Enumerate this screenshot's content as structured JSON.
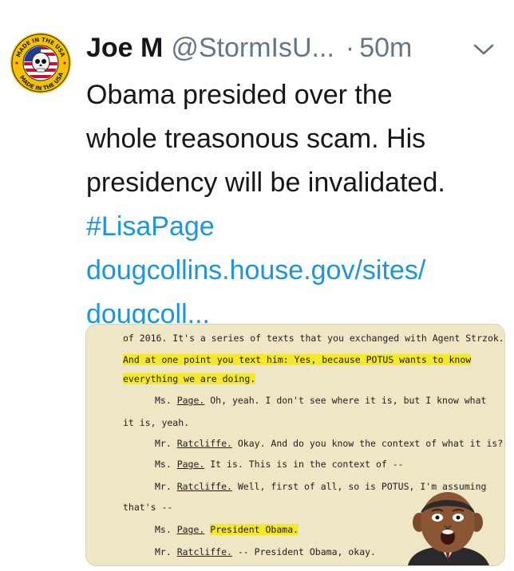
{
  "tweet": {
    "author_name": "Joe M",
    "handle": "@StormIsU...",
    "separator": "·",
    "time": "50m",
    "avatar": {
      "ring_text_top": "MADE IN THE USA",
      "ring_text_bottom": "MADE IN THE USA",
      "icon": "skull-flag-badge"
    },
    "menu_icon": "chevron-down-icon",
    "text_lines": [
      "Obama presided over the",
      "whole treasonous scam. His",
      "presidency will be invalidated."
    ],
    "hashtag": "#LisaPage",
    "link_lines": [
      "dougcollins.house.gov/sites/",
      "dougcoll..."
    ]
  },
  "media": {
    "doc_lines": [
      {
        "parts": [
          {
            "t": "of 2016.  It's a series of texts that you exchanged with Agent Strzok."
          }
        ]
      },
      {
        "parts": [
          {
            "t": "And at one point you text him:  Yes, because POTUS wants to know",
            "hl": true
          }
        ]
      },
      {
        "parts": [
          {
            "t": "everything we are doing.",
            "hl": true
          }
        ]
      },
      {
        "parts": [
          {
            "t": "Ms. "
          },
          {
            "t": "Page.",
            "u": true
          },
          {
            "t": "  Oh, yeah.  I don't see where it is, but I know what"
          }
        ]
      },
      {
        "parts": [
          {
            "t": "it is, yeah."
          }
        ]
      },
      {
        "parts": [
          {
            "t": "Mr. "
          },
          {
            "t": "Ratcliffe.",
            "u": true
          },
          {
            "t": "  Okay.  And do you know the context of what it is?"
          }
        ]
      },
      {
        "parts": [
          {
            "t": "Ms. "
          },
          {
            "t": "Page.",
            "u": true
          },
          {
            "t": "  It is.  This is in the context of --"
          }
        ]
      },
      {
        "parts": [
          {
            "t": "Mr. "
          },
          {
            "t": "Ratcliffe.",
            "u": true
          },
          {
            "t": "  Well, first of all, so is POTUS, I'm assuming"
          }
        ]
      },
      {
        "parts": [
          {
            "t": "that's --"
          }
        ]
      },
      {
        "parts": [
          {
            "t": "Ms. "
          },
          {
            "t": "Page.",
            "u": true
          },
          {
            "t": " "
          },
          {
            "t": "President Obama.",
            "hl": true
          }
        ]
      },
      {
        "parts": [
          {
            "t": "Mr. "
          },
          {
            "t": "Ratcliffe.",
            "u": true
          },
          {
            "t": "  -- President Obama, okay."
          }
        ]
      }
    ],
    "highlight_color": "#f3e82a",
    "overlay_icon": "surprised-face-cutout"
  },
  "colors": {
    "link": "#1b95e0",
    "secondary": "#657786",
    "primary": "#14171a"
  }
}
